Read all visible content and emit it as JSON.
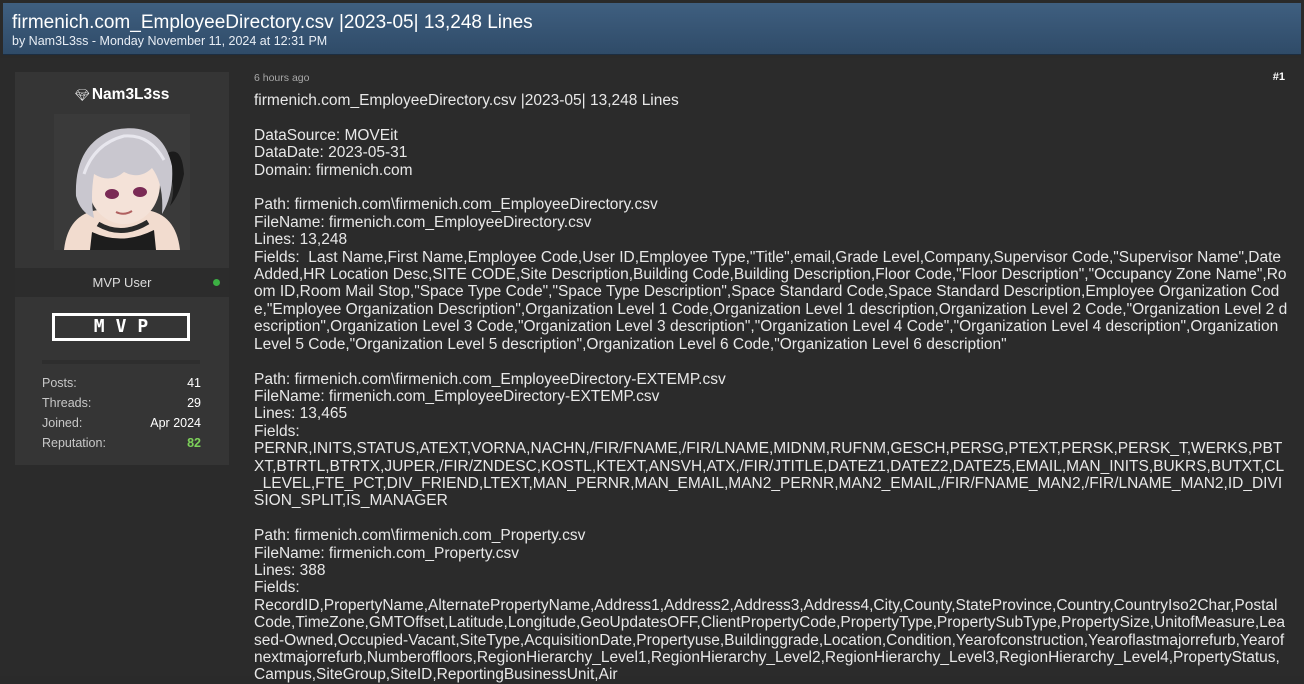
{
  "thread": {
    "title": "firmenich.com_EmployeeDirectory.csv |2023-05| 13,248 Lines",
    "byline": "by Nam3L3ss - Monday November 11, 2024 at 12:31 PM"
  },
  "author": {
    "gem_icon": "diamond-icon",
    "name": "Nam3L3ss",
    "user_title": "MVP User",
    "online": true,
    "badge": "MVP",
    "colors": {
      "online": "#3cb043",
      "reputation": "#7dd15a",
      "header": "#3f5f80"
    },
    "stats": [
      {
        "label": "Posts:",
        "value": "41"
      },
      {
        "label": "Threads:",
        "value": "29"
      },
      {
        "label": "Joined:",
        "value": "Apr 2024"
      },
      {
        "label": "Reputation:",
        "value": "82"
      }
    ]
  },
  "post": {
    "time": "6 hours ago",
    "number": "#1",
    "body": "firmenich.com_EmployeeDirectory.csv |2023-05| 13,248 Lines\n\nDataSource: MOVEit\nDataDate: 2023-05-31\nDomain: firmenich.com\n\nPath: firmenich.com\\firmenich.com_EmployeeDirectory.csv\nFileName: firmenich.com_EmployeeDirectory.csv\nLines: 13,248\nFields:  Last Name,First Name,Employee Code,User ID,Employee Type,\"Title\",email,Grade Level,Company,Supervisor Code,\"Supervisor Name\",Date Added,HR Location Desc,SITE CODE,Site Description,Building Code,Building Description,Floor Code,\"Floor Description\",\"Occupancy Zone Name\",Room ID,Room Mail Stop,\"Space Type Code\",\"Space Type Description\",Space Standard Code,Space Standard Description,Employee Organization Code,\"Employee Organization Description\",Organization Level 1 Code,Organization Level 1 description,Organization Level 2 Code,\"Organization Level 2 description\",Organization Level 3 Code,\"Organization Level 3 description\",\"Organization Level 4 Code\",\"Organization Level 4 description\",Organization Level 5 Code,\"Organization Level 5 description\",Organization Level 6 Code,\"Organization Level 6 description\"\n\nPath: firmenich.com\\firmenich.com_EmployeeDirectory-EXTEMP.csv\nFileName: firmenich.com_EmployeeDirectory-EXTEMP.csv\nLines: 13,465\nFields:\nPERNR,INITS,STATUS,ATEXT,VORNA,NACHN,/FIR/FNAME,/FIR/LNAME,MIDNM,RUFNM,GESCH,PERSG,PTEXT,PERSK,PERSK_T,WERKS,PBTXT,BTRTL,BTRTX,JUPER,/FIR/ZNDESC,KOSTL,KTEXT,ANSVH,ATX,/FIR/JTITLE,DATEZ1,DATEZ2,DATEZ5,EMAIL,MAN_INITS,BUKRS,BUTXT,CL_LEVEL,FTE_PCT,DIV_FRIEND,LTEXT,MAN_PERNR,MAN_EMAIL,MAN2_PERNR,MAN2_EMAIL,/FIR/FNAME_MAN2,/FIR/LNAME_MAN2,ID_DIVISION_SPLIT,IS_MANAGER\n\nPath: firmenich.com\\firmenich.com_Property.csv\nFileName: firmenich.com_Property.csv\nLines: 388\nFields:\nRecordID,PropertyName,AlternatePropertyName,Address1,Address2,Address3,Address4,City,County,StateProvince,Country,CountryIso2Char,PostalCode,TimeZone,GMTOffset,Latitude,Longitude,GeoUpdatesOFF,ClientPropertyCode,PropertyType,PropertySubType,PropertySize,UnitofMeasure,Leased-Owned,Occupied-Vacant,SiteType,AcquisitionDate,Propertyuse,Buildinggrade,Location,Condition,Yearofconstruction,Yearoflastmajorrefurb,Yearofnextmajorrefurb,Numberoffloors,RegionHierarchy_Level1,RegionHierarchy_Level2,RegionHierarchy_Level3,RegionHierarchy_Level4,PropertyStatus,Campus,SiteGroup,SiteID,ReportingBusinessUnit,Air"
  }
}
